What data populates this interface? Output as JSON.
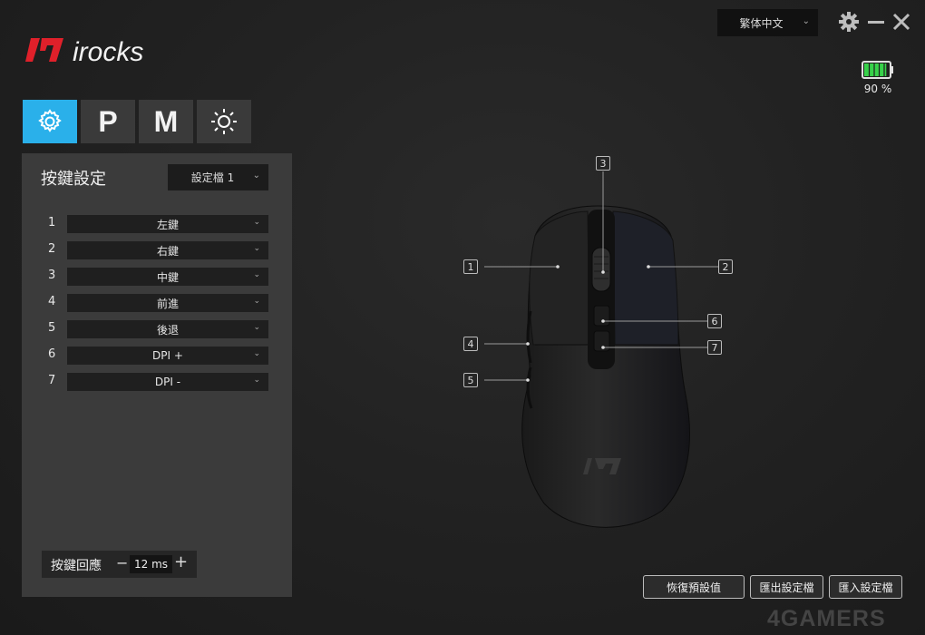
{
  "brand": {
    "logo_text": "irocks",
    "accent": "#e0202a"
  },
  "topbar": {
    "language": "繁体中文",
    "icons": [
      "gear-icon",
      "minimize-icon",
      "close-icon"
    ]
  },
  "battery": {
    "percent_text": "90 %",
    "level": 0.9,
    "color": "#37d24a"
  },
  "tabs": [
    {
      "id": "settings",
      "label": "",
      "icon": "gear-icon",
      "active": true
    },
    {
      "id": "performance",
      "label": "P",
      "active": false
    },
    {
      "id": "macro",
      "label": "M",
      "active": false
    },
    {
      "id": "lighting",
      "label": "",
      "icon": "sun-icon",
      "active": false
    }
  ],
  "accent_color": "#2ab0ea",
  "panel": {
    "title": "按鍵設定",
    "profile": "設定檔 1",
    "buttons": [
      {
        "num": "1",
        "value": "左鍵"
      },
      {
        "num": "2",
        "value": "右鍵"
      },
      {
        "num": "3",
        "value": "中鍵"
      },
      {
        "num": "4",
        "value": "前進"
      },
      {
        "num": "5",
        "value": "後退"
      },
      {
        "num": "6",
        "value": "DPI +"
      },
      {
        "num": "7",
        "value": "DPI -"
      }
    ],
    "response": {
      "label": "按鍵回應",
      "minus": "−",
      "value": "12 ms",
      "plus": "+"
    }
  },
  "callouts": [
    "1",
    "2",
    "3",
    "4",
    "5",
    "6",
    "7"
  ],
  "footer": {
    "restore": "恢復預設值",
    "export": "匯出設定檔",
    "import": "匯入設定檔"
  },
  "watermark": "4GAMERS"
}
